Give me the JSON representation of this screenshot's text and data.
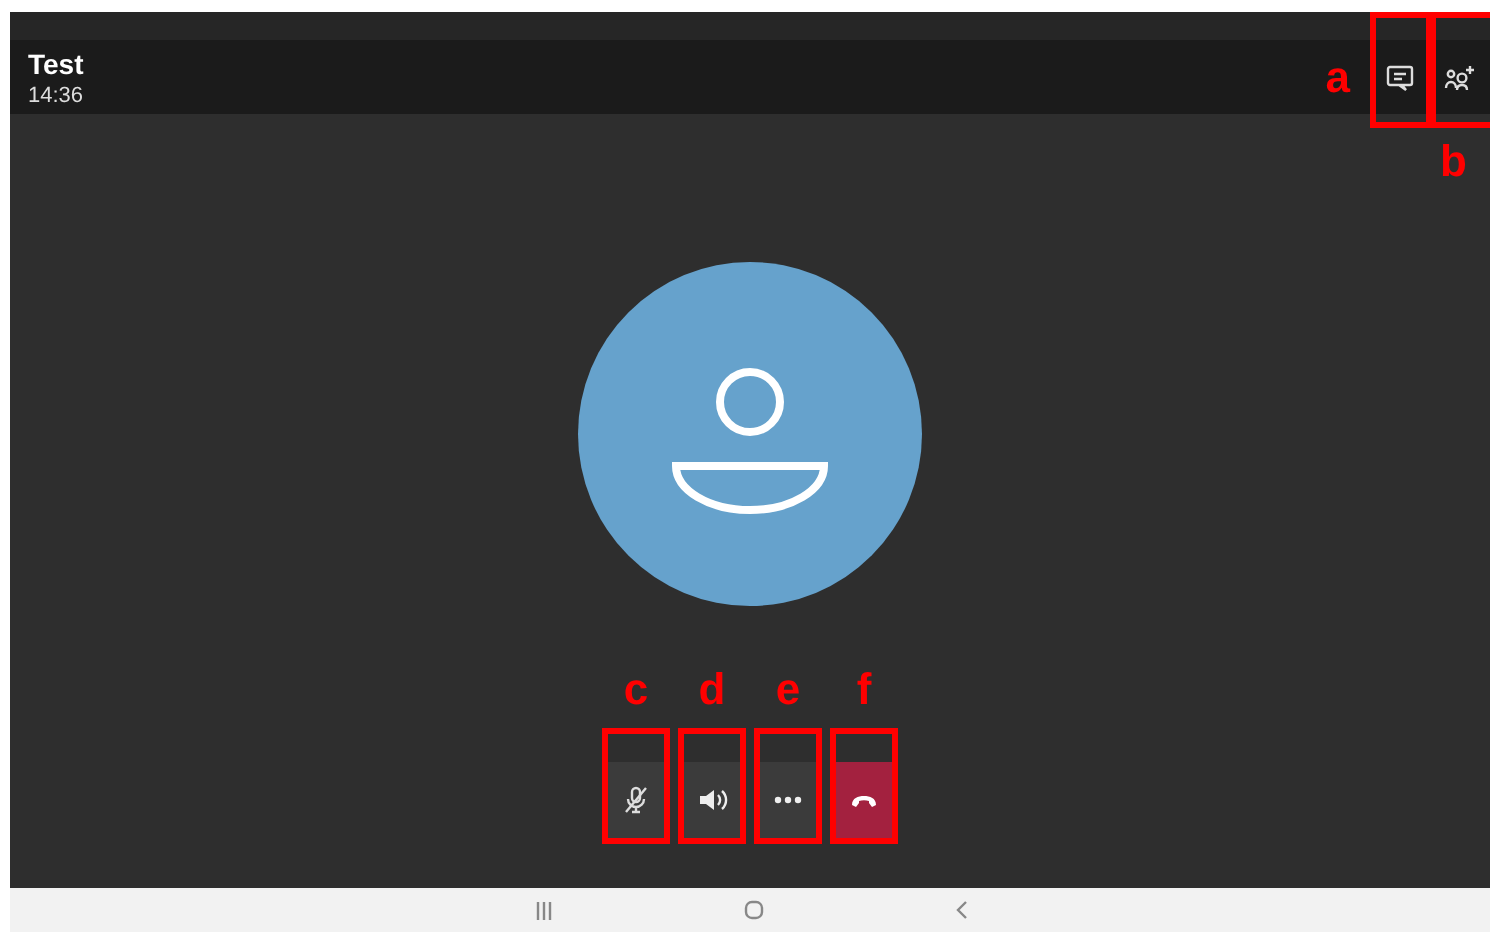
{
  "header": {
    "title": "Test",
    "time": "14:36"
  },
  "top_actions": [
    {
      "kind": "chat",
      "annotation": "a"
    },
    {
      "kind": "add-people",
      "annotation": "b"
    }
  ],
  "avatar": {
    "kind": "person"
  },
  "call_controls": [
    {
      "kind": "mute",
      "annotation": "c"
    },
    {
      "kind": "speaker",
      "annotation": "d"
    },
    {
      "kind": "more",
      "annotation": "e"
    },
    {
      "kind": "hang-up",
      "annotation": "f"
    }
  ]
}
